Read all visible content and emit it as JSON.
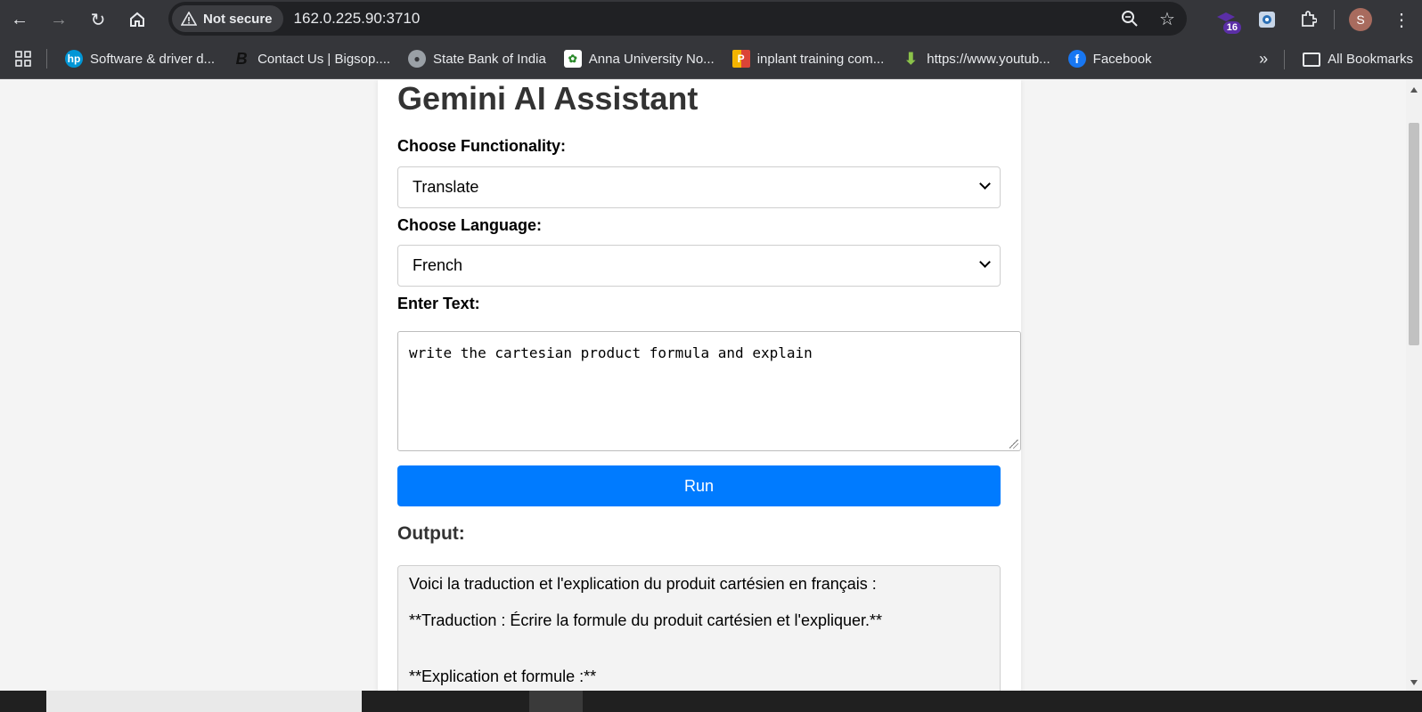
{
  "browser": {
    "security_label": "Not secure",
    "url": "162.0.225.90:3710",
    "extension_badge": "16",
    "profile_initial": "S"
  },
  "bookmarks": {
    "items": [
      {
        "label": "Software & driver d...",
        "icon": "hp-icon"
      },
      {
        "label": "Contact Us | Bigsop....",
        "icon": "bigsop-icon"
      },
      {
        "label": "State Bank of India",
        "icon": "globe-icon"
      },
      {
        "label": "Anna University No...",
        "icon": "anna-icon"
      },
      {
        "label": "inplant training com...",
        "icon": "inplant-icon"
      },
      {
        "label": "https://www.youtub...",
        "icon": "download-icon"
      },
      {
        "label": "Facebook",
        "icon": "facebook-icon"
      }
    ],
    "more": "»",
    "all_bookmarks": "All Bookmarks"
  },
  "app": {
    "title": "Gemini AI Assistant",
    "functionality_label": "Choose Functionality:",
    "functionality_value": "Translate",
    "language_label": "Choose Language:",
    "language_value": "French",
    "text_label": "Enter Text:",
    "text_value": "write the cartesian product formula and explain",
    "run_label": "Run",
    "output_heading": "Output:",
    "output_lines": [
      "Voici la traduction et l'explication du produit cartésien en français :",
      "**Traduction : Écrire la formule du produit cartésien et l'expliquer.**",
      "**Explication et formule :**"
    ]
  },
  "colors": {
    "run_button": "#007bff",
    "chrome_bg": "#35363a"
  }
}
